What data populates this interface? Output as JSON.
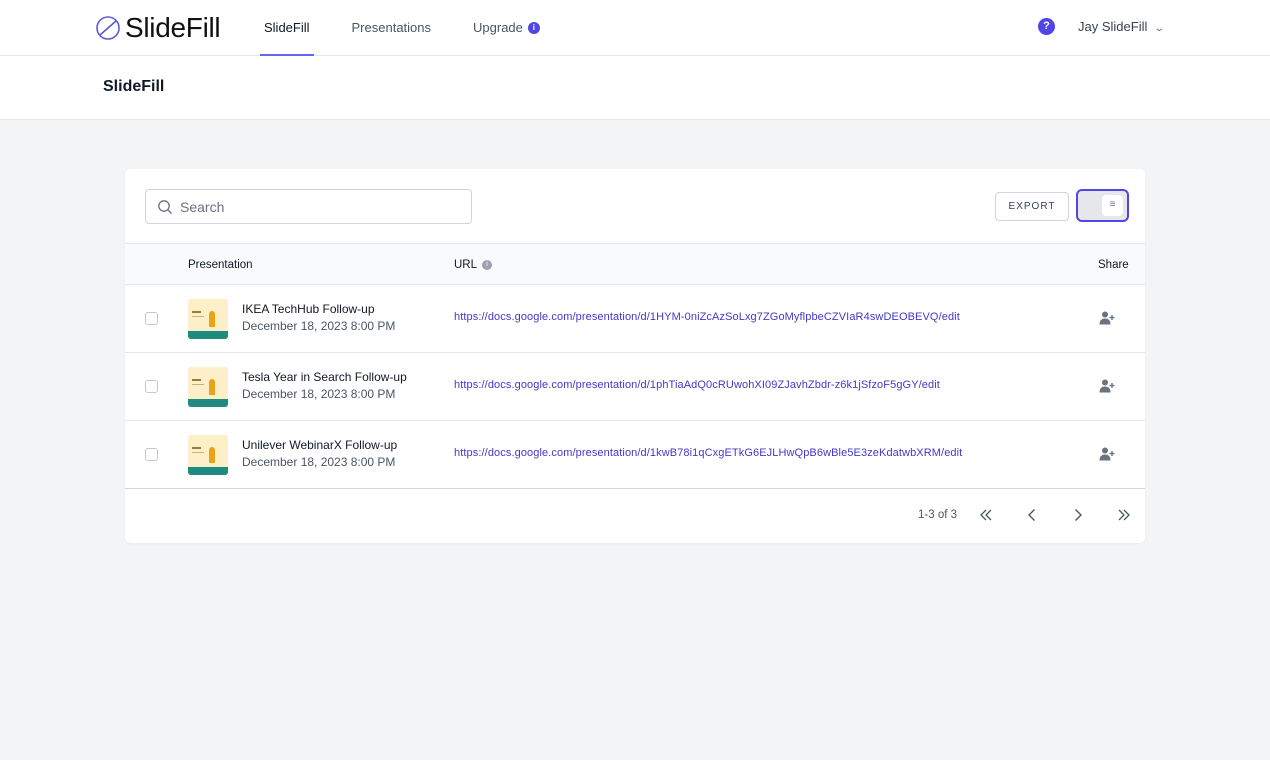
{
  "app": {
    "logo_text": "SlideFill",
    "nav": [
      {
        "label": "SlideFill",
        "active": true
      },
      {
        "label": "Presentations",
        "active": false
      },
      {
        "label": "Upgrade",
        "active": false,
        "badge": "i"
      }
    ],
    "help_label": "?",
    "user_name": "Jay SlideFill",
    "accent": "#4f46e5"
  },
  "page": {
    "title": "SlideFill"
  },
  "toolbar": {
    "search_placeholder": "Search",
    "search_value": "",
    "export_label": "EXPORT"
  },
  "table": {
    "columns": {
      "presentation": "Presentation",
      "url": "URL",
      "url_info": "i",
      "share": "Share"
    },
    "rows": [
      {
        "name": "IKEA TechHub Follow-up",
        "date": "December 18, 2023 8:00 PM",
        "url": "https://docs.google.com/presentation/d/1HYM-0niZcAzSoLxg7ZGoMyflpbeCZVIaR4swDEOBEVQ/edit"
      },
      {
        "name": "Tesla Year in Search Follow-up",
        "date": "December 18, 2023 8:00 PM",
        "url": "https://docs.google.com/presentation/d/1phTiaAdQ0cRUwohXI09ZJavhZbdr-z6k1jSfzoF5gGY/edit"
      },
      {
        "name": "Unilever WebinarX Follow-up",
        "date": "December 18, 2023 8:00 PM",
        "url": "https://docs.google.com/presentation/d/1kwB78i1qCxgETkG6EJLHwQpB6wBle5E3zeKdatwbXRM/edit"
      }
    ]
  },
  "pagination": {
    "range_text": "1-3 of 3"
  },
  "icons": {
    "logo": "slash-circle-icon",
    "search": "search-icon",
    "toggle": "list-view-icon",
    "share": "add-user-icon",
    "first": "double-chevron-left-icon",
    "prev": "chevron-left-icon",
    "next": "chevron-right-icon",
    "last": "double-chevron-right-icon"
  }
}
